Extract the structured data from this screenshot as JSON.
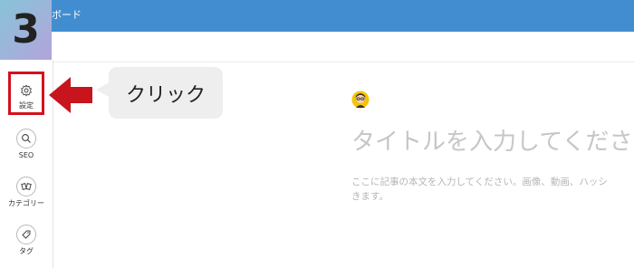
{
  "step": {
    "number": "3"
  },
  "topbar": {
    "title": "ボード"
  },
  "sidebar": {
    "items": [
      {
        "label": "設定",
        "icon": "gear-icon"
      },
      {
        "label": "SEO",
        "icon": "search-icon"
      },
      {
        "label": "カテゴリー",
        "icon": "category-icon"
      },
      {
        "label": "タグ",
        "icon": "tag-icon"
      }
    ]
  },
  "callout": {
    "text": "クリック"
  },
  "editor": {
    "title_placeholder": "タイトルを入力してくださ",
    "body_placeholder": "ここに記事の本文を入力してください。画像、動画、ハッシ\nきます。"
  },
  "colors": {
    "topbar": "#428dd0",
    "highlight": "#d3121c",
    "arrow": "#c8151d",
    "bubble": "#eeeeee"
  }
}
